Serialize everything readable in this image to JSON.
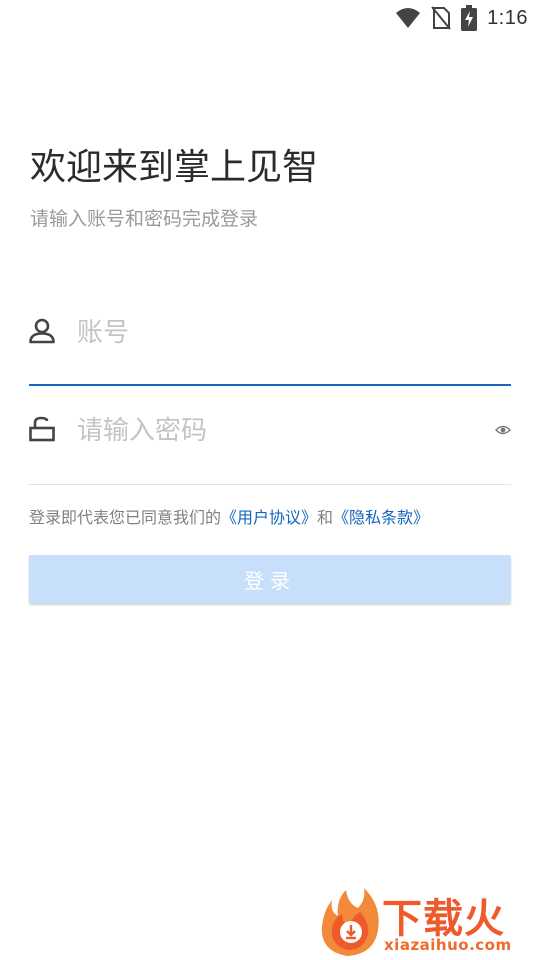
{
  "status_bar": {
    "time": "1:16",
    "icons": [
      "wifi-icon",
      "no-sim-icon",
      "battery-charging-icon"
    ]
  },
  "welcome": {
    "title": "欢迎来到掌上见智",
    "subtitle": "请输入账号和密码完成登录"
  },
  "form": {
    "account": {
      "placeholder": "账号",
      "value": "",
      "icon": "user-icon"
    },
    "password": {
      "placeholder": "请输入密码",
      "value": "",
      "icon": "lock-icon",
      "toggle_icon": "eye-icon"
    }
  },
  "agreement": {
    "prefix": "登录即代表您已同意我们的",
    "user_agreement": "《用户协议》",
    "joiner": "和",
    "privacy_terms": "《隐私条款》"
  },
  "login_button": {
    "label": "登录"
  },
  "watermark": {
    "title": "下载火",
    "url": "xiazaihuo.com"
  },
  "colors": {
    "accent": "#1565c0",
    "button_disabled": "#c8dffb",
    "watermark": "#ee5a2a"
  }
}
